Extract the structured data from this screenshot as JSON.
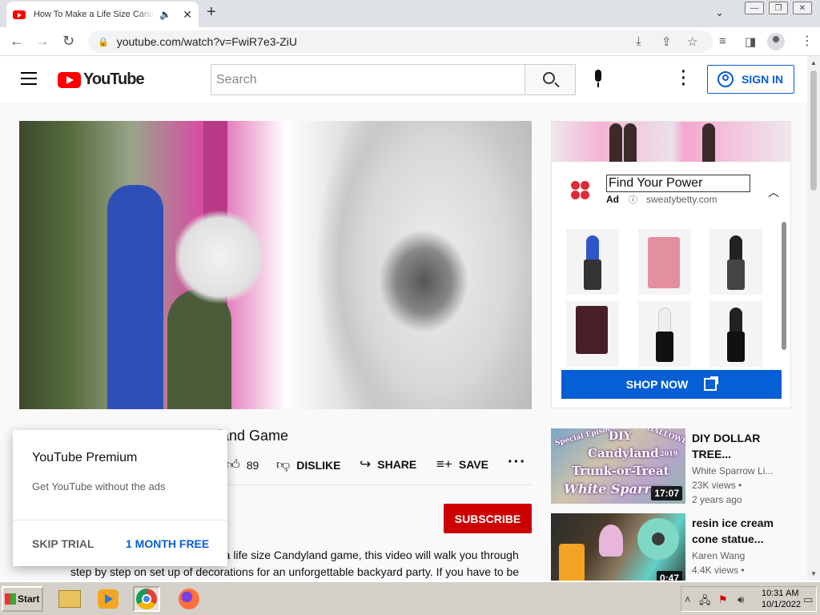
{
  "browser": {
    "tab_title": "How To Make a Life Size Candyland Game",
    "url": "youtube.com/watch?v=FwiR7e3-ZiU"
  },
  "youtube": {
    "logo_text": "YouTube",
    "search_placeholder": "Search",
    "signin_label": "SIGN IN"
  },
  "video": {
    "title_visible": "land Game",
    "like_count": "89",
    "dislike_label": "DISLIKE",
    "share_label": "SHARE",
    "save_label": "SAVE",
    "subscribe_label": "SUBSCRIBE",
    "description_line1": "e a life size Candyland game, this video will walk you through",
    "description_line2": "step by step on set up of decorations for an unforgettable backyard party. If you have to be"
  },
  "premium_popup": {
    "title": "YouTube Premium",
    "subtitle": "Get YouTube without the ads",
    "skip_label": "SKIP TRIAL",
    "free_label": "1 MONTH FREE"
  },
  "ad": {
    "headline": "Find Your Power",
    "tag": "Ad",
    "domain": "sweatybetty.com",
    "cta": "SHOP NOW"
  },
  "recommendations": [
    {
      "title": "DIY DOLLAR TREE...",
      "channel": "White Sparrow Li...",
      "views": "23K views",
      "age": "2 years ago",
      "duration": "17:07",
      "thumb_text": [
        "Special Episode",
        "DIY",
        "HALLOWEEN",
        "2019",
        "Candyland",
        "Trunk-or-Treat",
        "White Sparrow"
      ]
    },
    {
      "title": "resin ice cream cone statue...",
      "channel": "Karen Wang",
      "views": "4.4K views",
      "age": "",
      "duration": "0:47"
    }
  ],
  "taskbar": {
    "start_label": "Start",
    "time": "10:31 AM",
    "date": "10/1/2022"
  },
  "colors": {
    "yt_red": "#ff0000",
    "subscribe_red": "#cc0000",
    "link_blue": "#065fd4"
  }
}
